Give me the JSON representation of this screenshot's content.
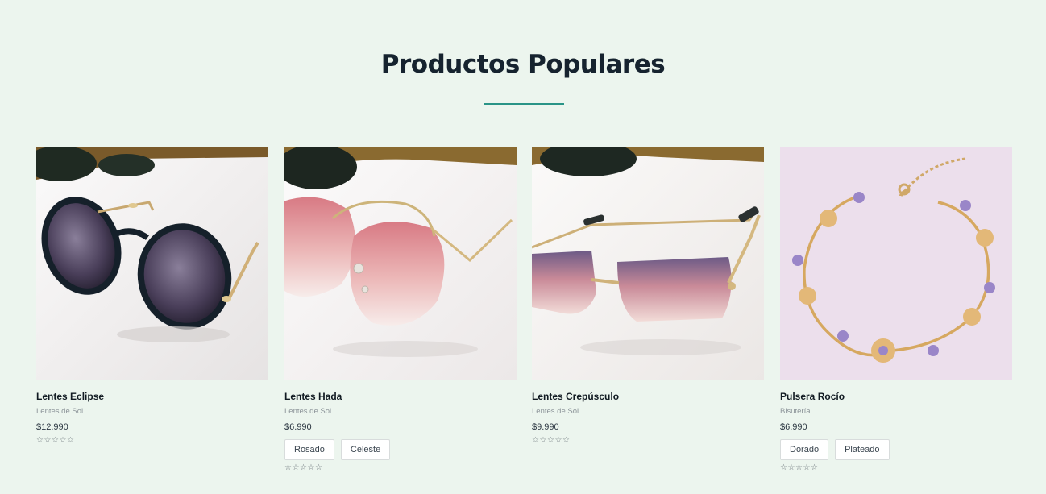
{
  "section": {
    "title": "Productos Populares",
    "accent_color": "#2a9487"
  },
  "products": [
    {
      "name": "Lentes Eclipse",
      "category": "Lentes de Sol",
      "price": "$12.990",
      "variants": [],
      "rating": 0,
      "image_icon": "round-black-sunglasses"
    },
    {
      "name": "Lentes Hada",
      "category": "Lentes de Sol",
      "price": "$6.990",
      "variants": [
        "Rosado",
        "Celeste"
      ],
      "rating": 0,
      "image_icon": "rimless-pink-sunglasses"
    },
    {
      "name": "Lentes Crepúsculo",
      "category": "Lentes de Sol",
      "price": "$9.990",
      "variants": [],
      "rating": 0,
      "image_icon": "rectangular-pink-sunglasses"
    },
    {
      "name": "Pulsera Rocío",
      "category": "Bisutería",
      "price": "$6.990",
      "variants": [
        "Dorado",
        "Plateado"
      ],
      "rating": 0,
      "image_icon": "gold-flower-bracelet"
    }
  ]
}
